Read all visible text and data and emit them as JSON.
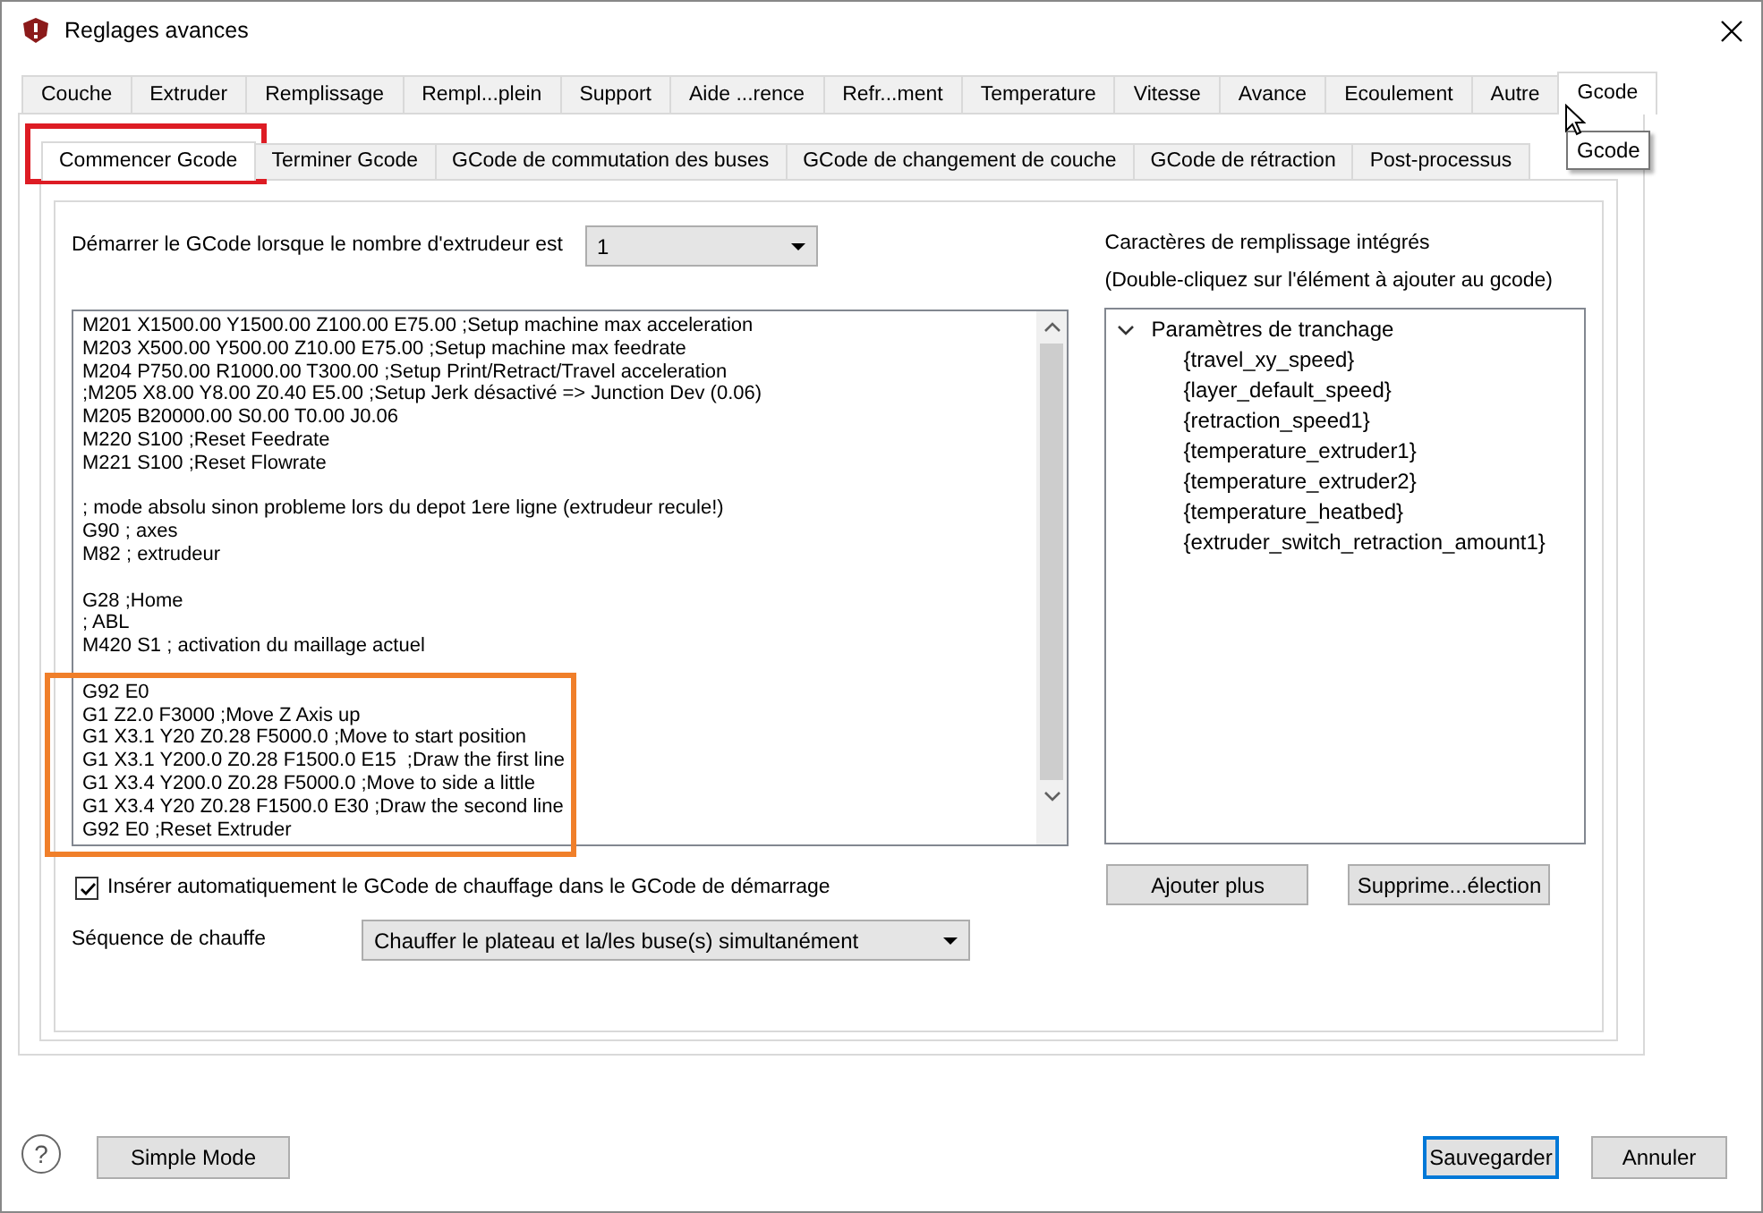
{
  "window": {
    "title": "Reglages avances"
  },
  "tabs": [
    {
      "label": "Couche",
      "selected": false
    },
    {
      "label": "Extruder",
      "selected": false
    },
    {
      "label": "Remplissage",
      "selected": false
    },
    {
      "label": "Rempl...plein",
      "selected": false
    },
    {
      "label": "Support",
      "selected": false
    },
    {
      "label": "Aide ...rence",
      "selected": false
    },
    {
      "label": "Refr...ment",
      "selected": false
    },
    {
      "label": "Temperature",
      "selected": false
    },
    {
      "label": "Vitesse",
      "selected": false
    },
    {
      "label": "Avance",
      "selected": false
    },
    {
      "label": "Ecoulement",
      "selected": false
    },
    {
      "label": "Autre",
      "selected": false
    },
    {
      "label": "Gcode",
      "selected": true
    }
  ],
  "tooltip": "Gcode",
  "subtabs": [
    {
      "label": "Commencer Gcode",
      "selected": true,
      "highlighted": true
    },
    {
      "label": "Terminer Gcode",
      "selected": false
    },
    {
      "label": "GCode de commutation des buses",
      "selected": false
    },
    {
      "label": "GCode de changement de couche",
      "selected": false
    },
    {
      "label": "GCode de rétraction",
      "selected": false
    },
    {
      "label": "Post-processus",
      "selected": false
    }
  ],
  "extruder_count": {
    "label": "Démarrer le GCode lorsque le nombre d'extrudeur est",
    "value": "1"
  },
  "gcode_blocks": [
    {
      "lines": [
        "M201 X1500.00 Y1500.00 Z100.00 E75.00 ;Setup machine max acceleration",
        "M203 X500.00 Y500.00 Z10.00 E75.00 ;Setup machine max feedrate",
        "M204 P750.00 R1000.00 T300.00 ;Setup Print/Retract/Travel acceleration",
        ";M205 X8.00 Y8.00 Z0.40 E5.00 ;Setup Jerk désactivé => Junction Dev (0.06)",
        "M205 B20000.00 S0.00 T0.00 J0.06",
        "M220 S100 ;Reset Feedrate",
        "M221 S100 ;Reset Flowrate"
      ]
    },
    {
      "lines": [
        "; mode absolu sinon probleme lors du depot 1ere ligne (extrudeur recule!)",
        "G90 ; axes",
        "M82 ; extrudeur"
      ]
    },
    {
      "lines": [
        "G28 ;Home",
        "; ABL",
        "M420 S1 ; activation du maillage actuel"
      ]
    },
    {
      "highlighted": true,
      "lines": [
        "G92 E0",
        "G1 Z2.0 F3000 ;Move Z Axis up",
        "G1 X3.1 Y20 Z0.28 F5000.0 ;Move to start position",
        "G1 X3.1 Y200.0 Z0.28 F1500.0 E15  ;Draw the first line",
        "G1 X3.4 Y200.0 Z0.28 F5000.0 ;Move to side a little",
        "G1 X3.4 Y20 Z0.28 F1500.0 E30 ;Draw the second line",
        "G92 E0 ;Reset Extruder"
      ]
    }
  ],
  "auto_insert": {
    "label": "Insérer automatiquement le GCode de chauffage dans le GCode de démarrage",
    "checked": true
  },
  "heat_sequence": {
    "label": "Séquence de chauffe",
    "value": "Chauffer le plateau et la/les buse(s) simultanément"
  },
  "builtin": {
    "title": "Caractères de remplissage intégrés",
    "hint": "(Double-cliquez sur l'élément à ajouter au gcode)",
    "tree": [
      {
        "label": "Paramètres de tranchage",
        "expanded": true,
        "children": [
          {
            "label": "{travel_xy_speed}"
          },
          {
            "label": "{layer_default_speed}"
          },
          {
            "label": "{retraction_speed1}"
          },
          {
            "label": "{temperature_extruder1}"
          },
          {
            "label": "{temperature_extruder2}"
          },
          {
            "label": "{temperature_heatbed}"
          },
          {
            "label": "{extruder_switch_retraction_amount1}"
          }
        ]
      }
    ],
    "buttons": [
      "Ajouter plus",
      "Supprime...élection"
    ]
  },
  "footer": {
    "help": "?",
    "left_buttons": [
      {
        "label": "Simple Mode",
        "default": false
      }
    ],
    "right_buttons": [
      {
        "label": "Sauvegarder",
        "default": true
      },
      {
        "label": "Annuler",
        "default": false
      }
    ]
  }
}
